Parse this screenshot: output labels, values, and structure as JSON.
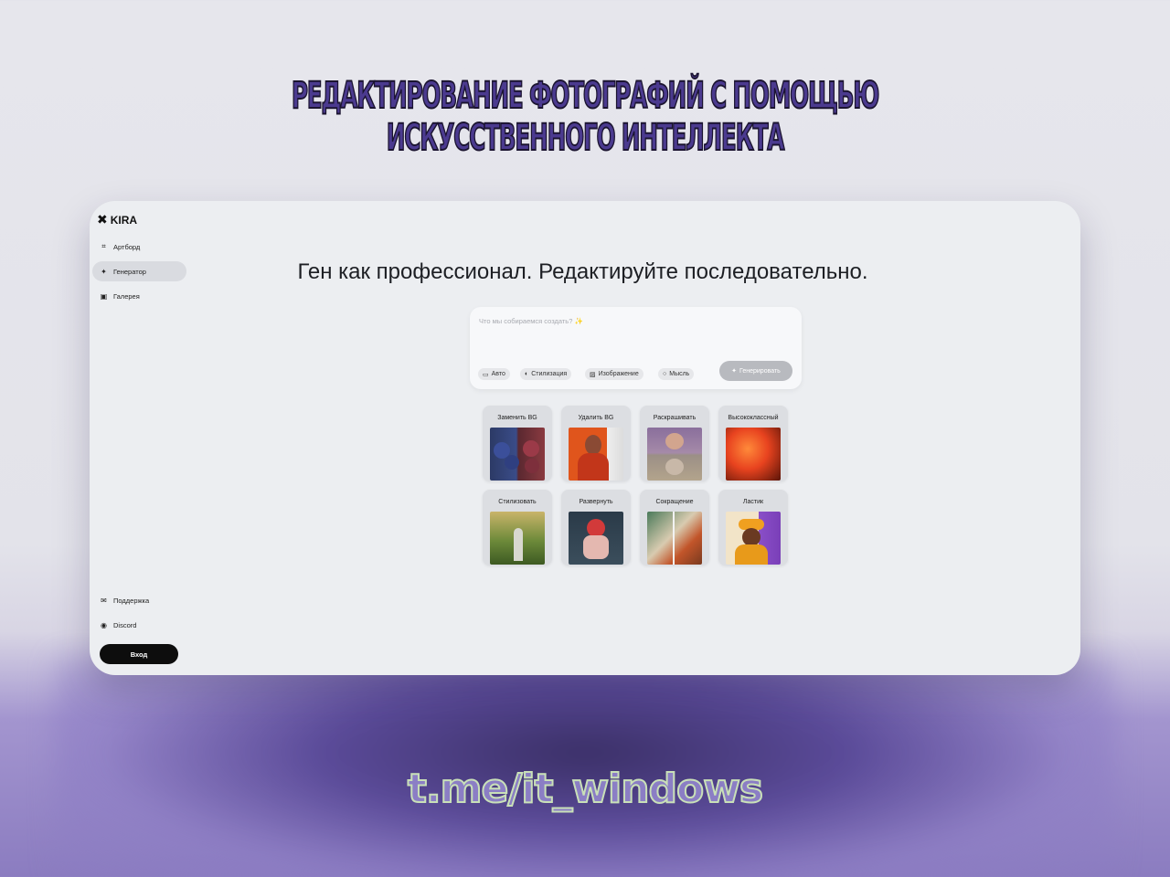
{
  "page": {
    "headline": "РЕДАКТИРОВАНИЕ ФОТОГРАФИЙ С ПОМОЩЬЮ ИСКУССТВЕННОГО ИНТЕЛЛЕКТА",
    "footer_link": "t.me/it_windows"
  },
  "app": {
    "logo_text": "KIRA",
    "sidebar": {
      "items": [
        {
          "label": "Артборд",
          "icon": "artboard-icon"
        },
        {
          "label": "Генератор",
          "icon": "sparkle-icon",
          "active": true
        },
        {
          "label": "Галерея",
          "icon": "gallery-icon"
        }
      ],
      "bottom_items": [
        {
          "label": "Поддержка",
          "icon": "mail-icon"
        },
        {
          "label": "Discord",
          "icon": "discord-icon"
        }
      ],
      "login_label": "Вход"
    },
    "hero_title": "Ген как профессионал. Редактируйте последовательно.",
    "prompt": {
      "placeholder": "Что мы собираемся создать?",
      "chips": [
        {
          "label": "Авто",
          "icon": "card-icon"
        },
        {
          "label": "Стилизация",
          "icon": "palette-icon"
        },
        {
          "label": "Изображение",
          "icon": "image-icon"
        },
        {
          "label": "Мысль",
          "icon": "bulb-icon"
        }
      ],
      "generate_label": "Генерировать"
    },
    "tools": [
      {
        "label": "Заменить BG"
      },
      {
        "label": "Удалить BG"
      },
      {
        "label": "Раскрашивать"
      },
      {
        "label": "Высококлассный"
      },
      {
        "label": "Стилизовать"
      },
      {
        "label": "Развернуть"
      },
      {
        "label": "Сокращение"
      },
      {
        "label": "Ластик"
      }
    ]
  },
  "colors": {
    "accent_dark": "#0d0d0d",
    "headline_fill": "#4b3a8f",
    "button_disabled": "#b8babf"
  }
}
